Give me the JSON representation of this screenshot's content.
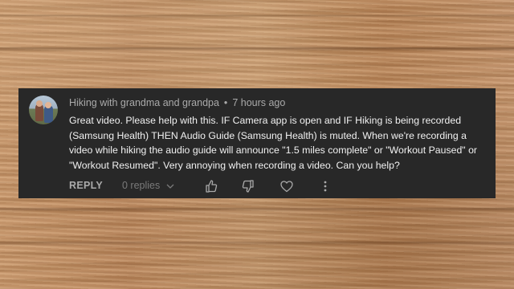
{
  "comment": {
    "author": "Hiking with grandma and grandpa",
    "separator": "•",
    "time": "7 hours ago",
    "text": "Great video. Please help with this. IF Camera app is open and IF Hiking is being recorded (Samsung Health) THEN Audio Guide (Samsung Health) is muted. When we're recording a video while hiking the audio guide will announce \"1.5 miles complete\" or \"Workout Paused\" or \"Workout Resumed\". Very annoying when recording a video. Can you help?"
  },
  "actions": {
    "reply_label": "REPLY",
    "replies_label": "0 replies"
  },
  "icons": {
    "expand": "chevron-down-icon",
    "like": "thumbs-up-icon",
    "dislike": "thumbs-down-icon",
    "heart": "heart-icon",
    "more": "more-vertical-icon"
  },
  "colors": {
    "card_bg": "#282828",
    "text_primary": "#f1f1f1",
    "text_secondary": "#aaaaaa"
  }
}
